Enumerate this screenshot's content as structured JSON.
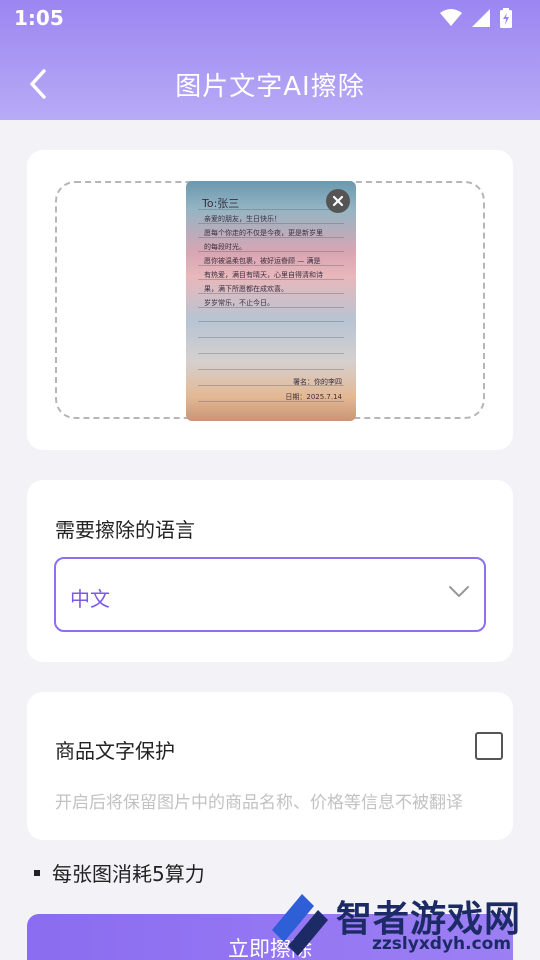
{
  "status": {
    "time": "1:05"
  },
  "header": {
    "title": "图片文字AI擦除"
  },
  "preview": {
    "to_line": "To:张三",
    "body_lines": [
      "亲爱的朋友，生日快乐！",
      "愿每个你走的不仅是今夜，更是新岁里",
      "的每段时光。",
      "愿你被温柔包裹，被好运眷顾 — 满是",
      "有热爱，满目有晴天，心里自得清和诗",
      "果，满下所愿都在成欢喜。",
      "岁岁常乐，不止今日。"
    ],
    "signature": "署名：你的李四",
    "date": "日期：2025.7.14"
  },
  "language": {
    "label": "需要擦除的语言",
    "selected": "中文"
  },
  "protect": {
    "label": "商品文字保护",
    "description": "开启后将保留图片中的商品名称、价格等信息不被翻译",
    "checked": false
  },
  "cost_note": "每张图消耗5算力",
  "start_button": "立即擦除",
  "watermark": {
    "title": "智者游戏网",
    "url": "zzslyxdyh.com"
  },
  "colors": {
    "accent": "#8f6ff0",
    "header_start": "#9b86f1",
    "header_end": "#b8abf6"
  }
}
